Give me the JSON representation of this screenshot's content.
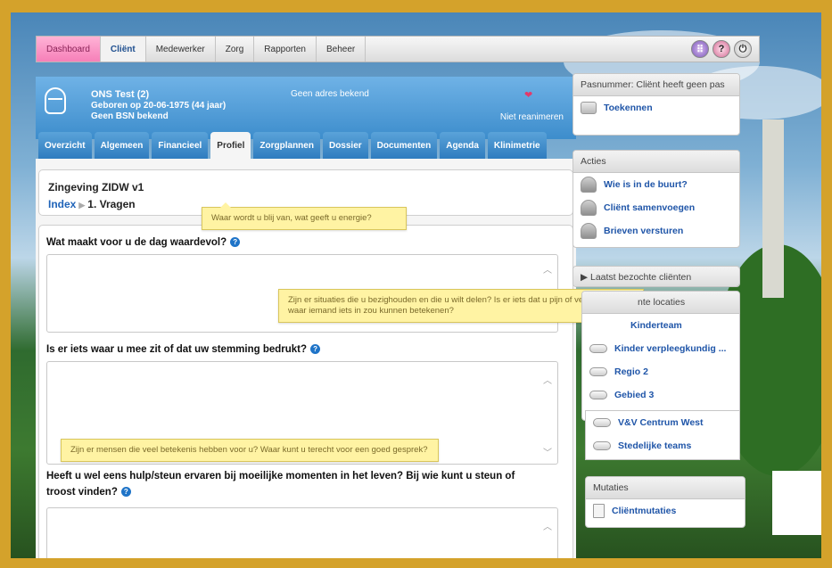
{
  "nav": {
    "tabs": [
      "Dashboard",
      "Cliënt",
      "Medewerker",
      "Zorg",
      "Rapporten",
      "Beheer"
    ],
    "active": "Cliënt",
    "icons": [
      "apps-grid-icon",
      "help-icon",
      "power-icon"
    ]
  },
  "client": {
    "name": "ONS Test (2)",
    "born": "Geboren op 20-06-1975 (44 jaar)",
    "bsn": "Geen BSN bekend",
    "address": "Geen adres bekend",
    "reanimation": "Niet reanimeren"
  },
  "profile_tabs": [
    "Overzicht",
    "Algemeen",
    "Financieel",
    "Profiel",
    "Zorgplannen",
    "Dossier",
    "Documenten",
    "Agenda",
    "Klinimetrie"
  ],
  "profile_active": "Profiel",
  "form": {
    "title": "Zingeving ZIDW v1",
    "breadcrumb_link": "Index",
    "breadcrumb_current": "1. Vragen",
    "questions": [
      "Wat maakt voor u de dag waardevol?",
      "Is er iets waar u mee zit of dat uw stemming bedrukt?",
      "Heeft u wel eens hulp/steun ervaren bij moeilijke momenten in het leven? Bij wie kunt u steun of troost vinden?"
    ],
    "tooltips": [
      "Waar wordt u blij van, wat geeft u energie?",
      "Zijn er situaties die u bezighouden en die u wilt delen? Is er iets dat u pijn of verdriet doet waar iemand iets in zou kunnen betekenen?",
      "Zijn er mensen die veel betekenis hebben voor u? Waar kunt u terecht voor een goed gesprek?"
    ]
  },
  "sidebar": {
    "pas": {
      "title": "Pasnummer: Cliënt heeft geen pas",
      "item": "Toekennen"
    },
    "acties": {
      "title": "Acties",
      "items": [
        "Wie is in de buurt?",
        "Cliënt samenvoegen",
        "Brieven versturen"
      ]
    },
    "laatst": {
      "title": "▶ Laatst bezochte cliënten"
    },
    "locaties": {
      "title_fragment": "nte locaties",
      "items": [
        "Kinderteam",
        "Kinder verpleegkundig ...",
        "Regio 2",
        "Gebied 3",
        "V&V Centrum West",
        "Stedelijke teams"
      ]
    },
    "mutaties": {
      "title": "Mutaties",
      "item": "Cliëntmutaties"
    }
  },
  "colors": {
    "frame_border": "#d4a22b",
    "header_blue": "#3d8dcc",
    "link_blue": "#1f55a8",
    "tooltip_yellow": "#fff3a3",
    "dashboard_pink": "#f67fb8"
  }
}
